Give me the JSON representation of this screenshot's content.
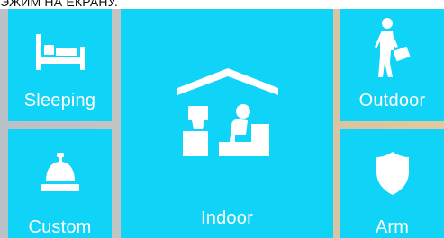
{
  "top_text": "ЭЖИМ НА ЕКРАНУ.",
  "tiles": {
    "sleeping": {
      "label": "Sleeping",
      "icon": "bed-icon"
    },
    "custom": {
      "label": "Custom",
      "icon": "bell-icon"
    },
    "indoor": {
      "label": "Indoor",
      "icon": "indoor-house-icon"
    },
    "outdoor": {
      "label": "Outdoor",
      "icon": "walking-person-icon"
    },
    "arm": {
      "label": "Arm",
      "icon": "shield-icon"
    }
  },
  "colors": {
    "tile": "#0fd3f7",
    "gap": "#c9c6c0",
    "text": "#ffffff"
  }
}
